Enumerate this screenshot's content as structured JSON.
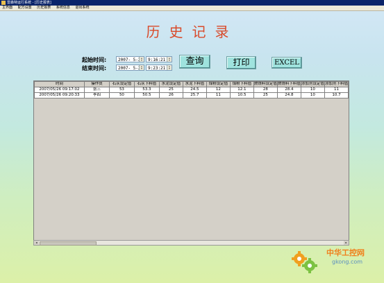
{
  "window": {
    "title": "雷森特运行系统 - [历史报表]"
  },
  "menu": [
    {
      "label": "主界面"
    },
    {
      "label": "配方设置"
    },
    {
      "label": "历史报表"
    },
    {
      "label": "系统信息"
    },
    {
      "label": "退出系统"
    }
  ],
  "page": {
    "title": "历史记录"
  },
  "query": {
    "start_label": "起始时间:",
    "end_label": "结束时间:",
    "start_date": "2007- 5-26",
    "start_time": "9:16:21",
    "end_date": "2007- 5-26",
    "end_time": "9:23:21"
  },
  "buttons": {
    "query": "查询",
    "print": "打印",
    "excel": "EXCEL"
  },
  "table": {
    "columns": [
      "时间",
      "操作员",
      "石灰设定值",
      "石灰下料值",
      "水泥设定值",
      "水泥下料值",
      "煤粉设定值",
      "煤粉下料值",
      "燃烧料设定值",
      "燃烧料下料值",
      "添加剂设定值",
      "添加剂下料值"
    ],
    "rows": [
      [
        "2007/05/26 09:17:02",
        "张三",
        "53",
        "53.3",
        "25",
        "24.5",
        "12",
        "12.1",
        "28",
        "28.4",
        "10",
        "11"
      ],
      [
        "2007/05/26 09:20:33",
        "李四",
        "50",
        "50.5",
        "26",
        "25.7",
        "11",
        "10.5",
        "25",
        "24.8",
        "10",
        "10.7"
      ]
    ]
  },
  "watermark": {
    "brand": "中华工控网",
    "url": "gkong.com"
  },
  "colors": {
    "title": "#d94a2a",
    "button": "#9fe3de",
    "titlebar": "#0a246a"
  }
}
